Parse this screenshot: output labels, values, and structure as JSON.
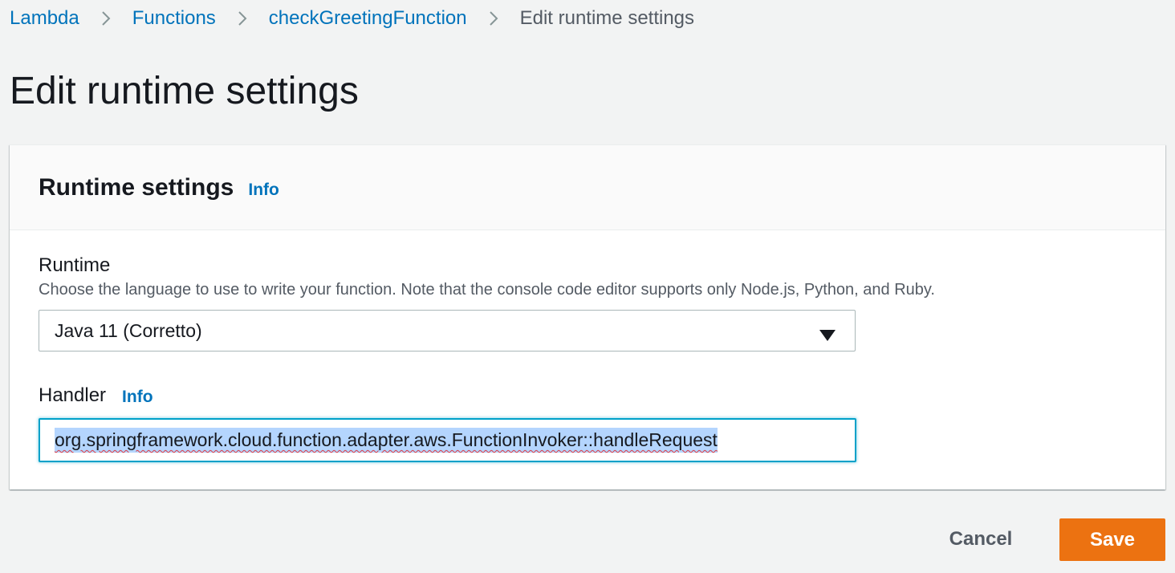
{
  "breadcrumb": {
    "items": [
      {
        "label": "Lambda"
      },
      {
        "label": "Functions"
      },
      {
        "label": "checkGreetingFunction"
      },
      {
        "label": "Edit runtime settings"
      }
    ]
  },
  "page": {
    "title": "Edit runtime settings"
  },
  "panel": {
    "title": "Runtime settings",
    "info_label": "Info",
    "runtime": {
      "label": "Runtime",
      "description": "Choose the language to use to write your function. Note that the console code editor supports only Node.js, Python, and Ruby.",
      "selected_value": "Java 11 (Corretto)"
    },
    "handler": {
      "label": "Handler",
      "info_label": "Info",
      "value": "org.springframework.cloud.function.adapter.aws.FunctionInvoker::handleRequest"
    }
  },
  "actions": {
    "cancel_label": "Cancel",
    "save_label": "Save"
  },
  "colors": {
    "link": "#0073bb",
    "primary_button": "#ec7211",
    "focus_border": "#00a1c9",
    "background": "#f2f3f3"
  },
  "icons": {
    "breadcrumb_separator": "chevron-right-icon",
    "select_caret": "caret-down-icon"
  }
}
